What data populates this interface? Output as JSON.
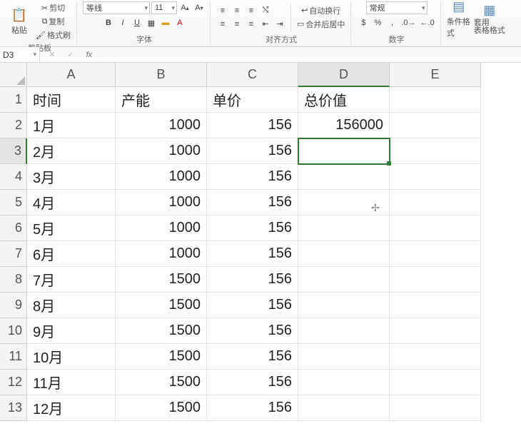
{
  "ribbon": {
    "clipboard": {
      "paste": "粘贴",
      "cut": "剪切",
      "copy": "复制",
      "format_painter": "格式刷",
      "label": "剪贴板"
    },
    "font": {
      "name": "等线",
      "size": "11",
      "bold": "B",
      "italic": "I",
      "underline": "U",
      "label": "字体"
    },
    "align": {
      "wrap": "自动换行",
      "merge": "合并后居中",
      "label": "对齐方式"
    },
    "number": {
      "format": "常规",
      "label": "数字"
    },
    "styles": {
      "cond_format": "条件格式",
      "table_format": "套用\n表格格式"
    }
  },
  "namebox": "D3",
  "columns": [
    "A",
    "B",
    "C",
    "D",
    "E"
  ],
  "headers": {
    "A": "时间",
    "B": "产能",
    "C": "单价",
    "D": "总价值"
  },
  "rows": [
    {
      "r": 1
    },
    {
      "r": 2,
      "A": "1月",
      "B": 1000,
      "C": 156,
      "D": 156000
    },
    {
      "r": 3,
      "A": "2月",
      "B": 1000,
      "C": 156
    },
    {
      "r": 4,
      "A": "3月",
      "B": 1000,
      "C": 156
    },
    {
      "r": 5,
      "A": "4月",
      "B": 1000,
      "C": 156
    },
    {
      "r": 6,
      "A": "5月",
      "B": 1000,
      "C": 156
    },
    {
      "r": 7,
      "A": "6月",
      "B": 1000,
      "C": 156
    },
    {
      "r": 8,
      "A": "7月",
      "B": 1500,
      "C": 156
    },
    {
      "r": 9,
      "A": "8月",
      "B": 1500,
      "C": 156
    },
    {
      "r": 10,
      "A": "9月",
      "B": 1500,
      "C": 156
    },
    {
      "r": 11,
      "A": "10月",
      "B": 1500,
      "C": 156
    },
    {
      "r": 12,
      "A": "11月",
      "B": 1500,
      "C": 156
    },
    {
      "r": 13,
      "A": "12月",
      "B": 1500,
      "C": 156
    }
  ],
  "selected_cell": "D3",
  "selected_col": "D",
  "selected_row": 3
}
